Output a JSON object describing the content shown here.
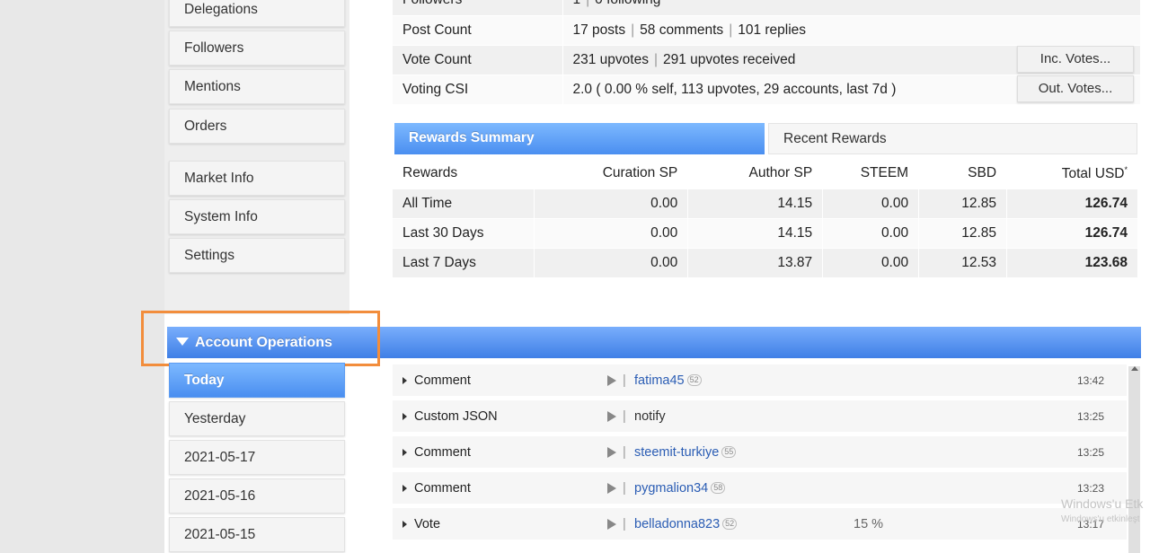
{
  "sidebar": {
    "items": [
      {
        "label": "Delegations"
      },
      {
        "label": "Followers"
      },
      {
        "label": "Mentions"
      },
      {
        "label": "Orders"
      },
      {
        "label": "Market Info"
      },
      {
        "label": "System Info"
      },
      {
        "label": "Settings"
      }
    ],
    "dates": [
      {
        "label": "Today"
      },
      {
        "label": "Yesterday"
      },
      {
        "label": "2021-05-17"
      },
      {
        "label": "2021-05-16"
      },
      {
        "label": "2021-05-15"
      }
    ]
  },
  "stats": {
    "followers_label": "Followers",
    "followers_value": "1",
    "following_value": "0 following",
    "post_count_label": "Post Count",
    "posts": "17 posts",
    "comments": "58 comments",
    "replies": "101 replies",
    "vote_count_label": "Vote Count",
    "upvotes": "231 upvotes",
    "upvotes_received": "291 upvotes received",
    "inc_votes_label": "Inc. Votes...",
    "voting_csi_label": "Voting CSI",
    "voting_csi_value": "2.0 ( 0.00 % self, 113 upvotes, 29 accounts, last 7d )",
    "out_votes_label": "Out. Votes..."
  },
  "tabs": {
    "rewards_summary": "Rewards Summary",
    "recent_rewards": "Recent Rewards"
  },
  "rewards": {
    "headers": [
      "Rewards",
      "Curation SP",
      "Author SP",
      "STEEM",
      "SBD",
      "Total USD"
    ],
    "total_marker": "*",
    "rows": [
      [
        "All Time",
        "0.00",
        "14.15",
        "0.00",
        "12.85",
        "126.74"
      ],
      [
        "Last 30 Days",
        "0.00",
        "14.15",
        "0.00",
        "12.85",
        "126.74"
      ],
      [
        "Last 7 Days",
        "0.00",
        "13.87",
        "0.00",
        "12.53",
        "123.68"
      ]
    ]
  },
  "operations": {
    "title": "Account Operations",
    "rows": [
      {
        "type": "Comment",
        "who": "fatima45",
        "rep": "52",
        "pct": "",
        "time": "13:42"
      },
      {
        "type": "Custom JSON",
        "who": "notify",
        "rep": "",
        "pct": "",
        "time": "13:25"
      },
      {
        "type": "Comment",
        "who": "steemit-turkiye",
        "rep": "55",
        "pct": "",
        "time": "13:25"
      },
      {
        "type": "Comment",
        "who": "pygmalion34",
        "rep": "58",
        "pct": "",
        "time": "13:23"
      },
      {
        "type": "Vote",
        "who": "belladonna823",
        "rep": "52",
        "pct": "15 %",
        "time": "13:17"
      }
    ]
  },
  "watermark": {
    "line1": "Windows'u Etk",
    "line2": "Windows'u etkinleşt"
  },
  "colors": {
    "accent": "#4a8ef0",
    "highlight": "#f28d3c",
    "link": "#2b5db4"
  }
}
